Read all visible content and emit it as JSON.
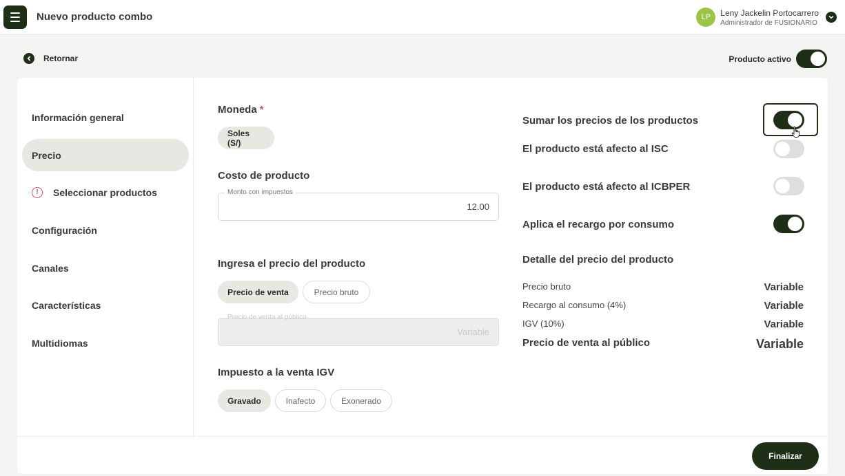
{
  "header": {
    "title": "Nuevo producto combo",
    "user_initials": "LP",
    "user_name": "Leny Jackelin Portocarrero",
    "user_role": "Administrador de FUSIONARIO"
  },
  "toolbar": {
    "back_label": "Retornar",
    "active_label": "Producto activo",
    "active_on": true
  },
  "sidebar": {
    "items": [
      {
        "label": "Información general",
        "active": false,
        "warning": false
      },
      {
        "label": "Precio",
        "active": true,
        "warning": false
      },
      {
        "label": "Seleccionar productos",
        "active": false,
        "warning": true,
        "warning_glyph": "!"
      },
      {
        "label": "Configuración",
        "active": false,
        "warning": false
      },
      {
        "label": "Canales",
        "active": false,
        "warning": false
      },
      {
        "label": "Características",
        "active": false,
        "warning": false
      },
      {
        "label": "Multidiomas",
        "active": false,
        "warning": false
      }
    ]
  },
  "price": {
    "currency_title": "Moneda",
    "required_mark": "*",
    "currency_option": "Soles (S/)",
    "cost_title": "Costo de producto",
    "cost_field_label": "Monto con impuestos",
    "cost_value": "12.00",
    "enter_price_title": "Ingresa el precio del producto",
    "price_options": [
      "Precio de venta",
      "Precio bruto"
    ],
    "public_price_label": "Precio de venta al público",
    "public_price_value": "Variable",
    "tax_title": "Impuesto a la venta IGV",
    "tax_options": [
      "Gravado",
      "Inafecto",
      "Exonerado"
    ]
  },
  "options": {
    "sum_prices": {
      "label": "Sumar los precios de los productos",
      "on": true
    },
    "isc": {
      "label": "El producto está afecto al ISC",
      "on": false
    },
    "icbper": {
      "label": "El producto está afecto al ICBPER",
      "on": false
    },
    "surcharge": {
      "label": "Aplica el recargo por consumo",
      "on": true
    }
  },
  "detail": {
    "title": "Detalle del precio del producto",
    "rows": [
      {
        "label": "Precio bruto",
        "value": "Variable"
      },
      {
        "label": "Recargo al consumo (4%)",
        "value": "Variable"
      },
      {
        "label": "IGV (10%)",
        "value": "Variable"
      }
    ],
    "total": {
      "label": "Precio de venta al público",
      "value": "Variable"
    }
  },
  "footer": {
    "finish_label": "Finalizar"
  },
  "colors": {
    "primary": "#1e2e17",
    "avatar": "#9dc447",
    "required": "#c7556f",
    "selected_bg": "#e6e9e1"
  }
}
